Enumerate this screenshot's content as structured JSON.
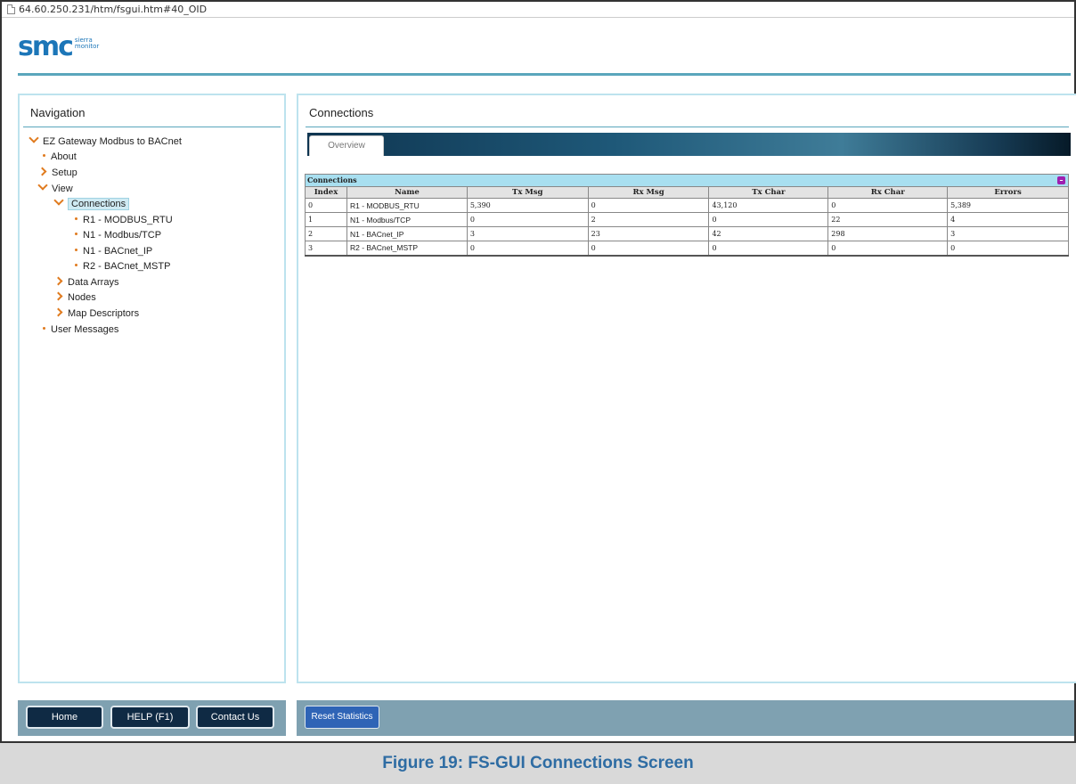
{
  "browser": {
    "url": "64.60.250.231/htm/fsgui.htm#40_OID"
  },
  "logo": {
    "text": "smc",
    "sub_line1": "sierra",
    "sub_line2": "monitor"
  },
  "navigation": {
    "title": "Navigation",
    "tree": [
      {
        "label": "EZ Gateway Modbus to BACnet",
        "state": "expanded",
        "level": 0
      },
      {
        "label": "About",
        "state": "leaf",
        "level": 1
      },
      {
        "label": "Setup",
        "state": "collapsed",
        "level": 1
      },
      {
        "label": "View",
        "state": "expanded",
        "level": 1
      },
      {
        "label": "Connections",
        "state": "expanded",
        "level": 2,
        "selected": true
      },
      {
        "label": "R1 - MODBUS_RTU",
        "state": "leaf",
        "level": 3
      },
      {
        "label": "N1 - Modbus/TCP",
        "state": "leaf",
        "level": 3
      },
      {
        "label": "N1 - BACnet_IP",
        "state": "leaf",
        "level": 3
      },
      {
        "label": "R2 - BACnet_MSTP",
        "state": "leaf",
        "level": 3
      },
      {
        "label": "Data Arrays",
        "state": "collapsed",
        "level": 2
      },
      {
        "label": "Nodes",
        "state": "collapsed",
        "level": 2
      },
      {
        "label": "Map Descriptors",
        "state": "collapsed",
        "level": 2
      },
      {
        "label": "User Messages",
        "state": "leaf",
        "level": 1
      }
    ]
  },
  "main": {
    "title": "Connections",
    "tab": "Overview",
    "table": {
      "caption": "Connections",
      "headers": [
        "Index",
        "Name",
        "Tx Msg",
        "Rx Msg",
        "Tx Char",
        "Rx Char",
        "Errors"
      ],
      "rows": [
        [
          "0",
          "R1 - MODBUS_RTU",
          "5,390",
          "0",
          "43,120",
          "0",
          "5,389"
        ],
        [
          "1",
          "N1 - Modbus/TCP",
          "0",
          "2",
          "0",
          "22",
          "4"
        ],
        [
          "2",
          "N1 - BACnet_IP",
          "3",
          "23",
          "42",
          "298",
          "3"
        ],
        [
          "3",
          "R2 - BACnet_MSTP",
          "0",
          "0",
          "0",
          "0",
          "0"
        ]
      ]
    }
  },
  "footer": {
    "home": "Home",
    "help": "HELP (F1)",
    "contact": "Contact Us",
    "reset": "Reset Statistics"
  },
  "caption": "Figure 19: FS-GUI Connections Screen",
  "colors": {
    "accent": "#e07b1f",
    "brand": "#1c76b8",
    "panel_border": "#bde3ee",
    "footer_bar": "#7fa1b1",
    "caption_text": "#2e6ca3"
  }
}
